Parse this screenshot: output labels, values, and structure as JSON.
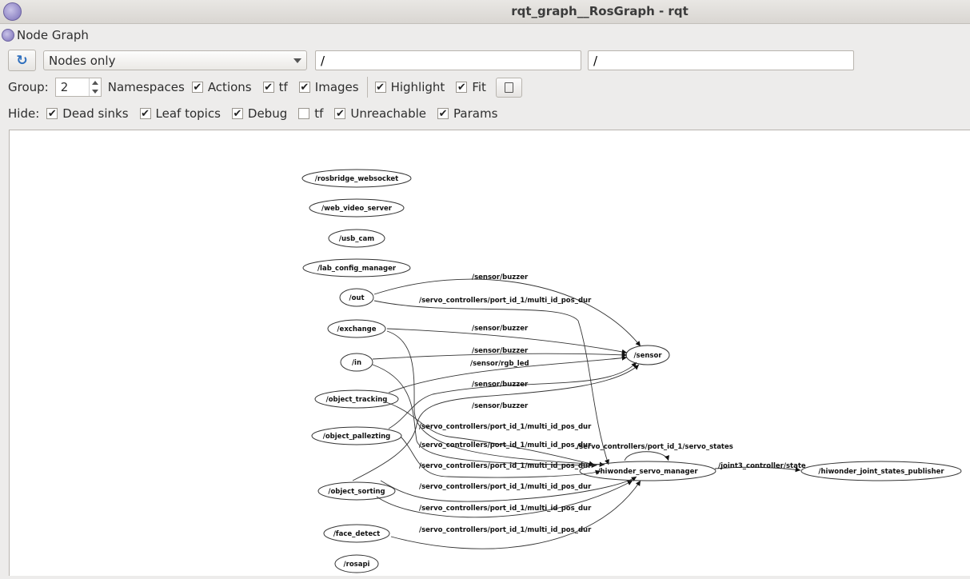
{
  "window": {
    "title": "rqt_graph__RosGraph - rqt"
  },
  "plugin": {
    "title": "Node Graph"
  },
  "toolbar": {
    "refresh_icon": "refresh-icon",
    "graph_type": "Nodes only",
    "node_filter": "/",
    "topic_filter": "/"
  },
  "options": {
    "group_label": "Group:",
    "group_value": "2",
    "namespaces_label": "Namespaces",
    "actions": {
      "label": "Actions",
      "checked": true
    },
    "tf": {
      "label": "tf",
      "checked": true
    },
    "images": {
      "label": "Images",
      "checked": true
    },
    "highlight": {
      "label": "Highlight",
      "checked": true
    },
    "fit": {
      "label": "Fit",
      "checked": true
    }
  },
  "hide": {
    "label": "Hide:",
    "dead_sinks": {
      "label": "Dead sinks",
      "checked": true
    },
    "leaf_topics": {
      "label": "Leaf topics",
      "checked": true
    },
    "debug": {
      "label": "Debug",
      "checked": true
    },
    "tf": {
      "label": "tf",
      "checked": false
    },
    "unreachable": {
      "label": "Unreachable",
      "checked": true
    },
    "params": {
      "label": "Params",
      "checked": true
    }
  },
  "graph": {
    "nodes": [
      "/rosbridge_websocket",
      "/web_video_server",
      "/usb_cam",
      "/lab_config_manager",
      "/out",
      "/exchange",
      "/in",
      "/object_tracking",
      "/object_pallezting",
      "/object_sorting",
      "/face_detect",
      "/rosapi",
      "/sensor",
      "/hiwonder_servo_manager",
      "/hiwonder_joint_states_publisher"
    ],
    "edge_labels": [
      "/sensor/buzzer",
      "/servo_controllers/port_id_1/multi_id_pos_dur",
      "/sensor/buzzer",
      "/sensor/buzzer",
      "/sensor/rgb_led",
      "/sensor/buzzer",
      "/sensor/buzzer",
      "/servo_controllers/port_id_1/multi_id_pos_dur",
      "/servo_controllers/port_id_1/multi_id_pos_dur",
      "/servo_controllers/port_id_1/servo_states",
      "/servo_controllers/port_id_1/multi_id_pos_dur",
      "/joint3_controller/state",
      "/servo_controllers/port_id_1/multi_id_pos_dur",
      "/servo_controllers/port_id_1/multi_id_pos_dur",
      "/servo_controllers/port_id_1/multi_id_pos_dur"
    ]
  }
}
